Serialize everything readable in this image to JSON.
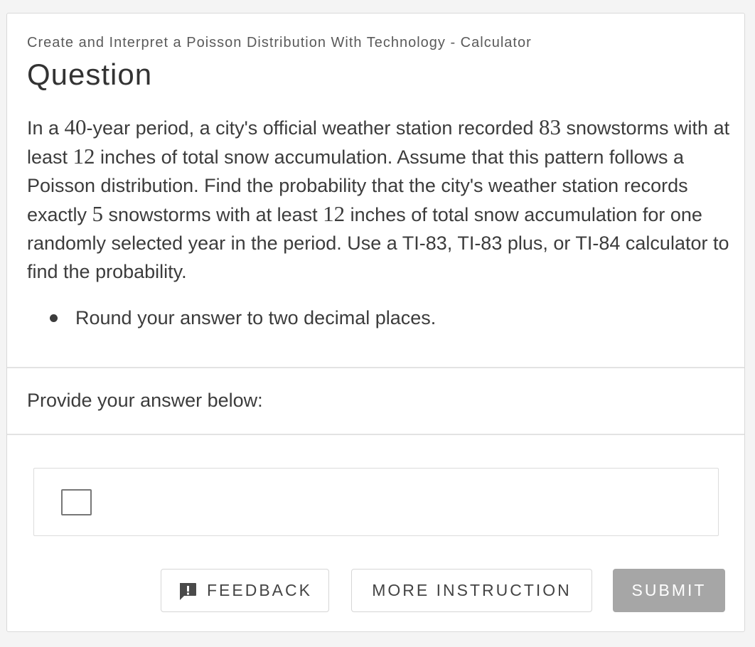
{
  "header": {
    "breadcrumb": "Create and Interpret a Poisson Distribution With Technology - Calculator",
    "title": "Question"
  },
  "question": {
    "text_1": "In a ",
    "num_1": "40",
    "text_2": "-year period, a city's official weather station recorded ",
    "num_2": "83",
    "text_3": " snowstorms with at least ",
    "num_3": "12",
    "text_4": " inches of total snow accumulation. Assume that this pattern follows a Poisson distribution. Find the probability that the city's weather station records exactly ",
    "num_4": "5",
    "text_5": " snowstorms with at least ",
    "num_5": "12",
    "text_6": " inches of total snow accumulation for one randomly selected year in the period. Use a TI-83, TI-83 plus, or TI-84 calculator to find the probability.",
    "bullets": [
      "Round your answer to two decimal places."
    ]
  },
  "answer": {
    "prompt": "Provide your answer below:",
    "value": ""
  },
  "buttons": {
    "feedback": "FEEDBACK",
    "feedback_icon": "feedback-icon",
    "more_instruction": "MORE INSTRUCTION",
    "submit": "SUBMIT"
  },
  "colors": {
    "submit_bg": "#a6a6a6",
    "text": "#3c3c3c"
  }
}
